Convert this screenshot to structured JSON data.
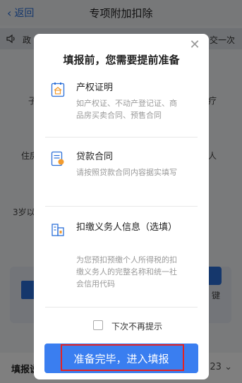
{
  "nav": {
    "back_label": "返回",
    "title": "专项附加扣除"
  },
  "notice": {
    "left_text": "政",
    "right_text": "交一次"
  },
  "background": {
    "frag_a_left": "子",
    "frag_a_right": "疗",
    "frag_b_left": "住房",
    "frag_b_right": "人",
    "frag_c": "3岁以",
    "card_key": "键",
    "bottom_left": "填报说",
    "bottom_right": "23"
  },
  "modal": {
    "heading": "填报前，您需要提前准备",
    "items": [
      {
        "title": "产权证明",
        "desc": "如产权证、不动产登记证、商品房买卖合同、预售合同",
        "icon": "property-certificate-icon"
      },
      {
        "title": "贷款合同",
        "desc": "请按照贷款合同内容据实填写",
        "icon": "loan-contract-icon"
      },
      {
        "title": "扣缴义务人信息（选填）",
        "desc": "为您预扣预缴个人所得税的扣缴义务人的完整名称和统一社会信用代码",
        "icon": "withholding-agent-icon"
      }
    ],
    "checkbox_label": "下次不再提示",
    "confirm_label": "准备完毕，进入填报"
  },
  "colors": {
    "accent": "#3a7ef0",
    "highlight": "#e52222"
  }
}
